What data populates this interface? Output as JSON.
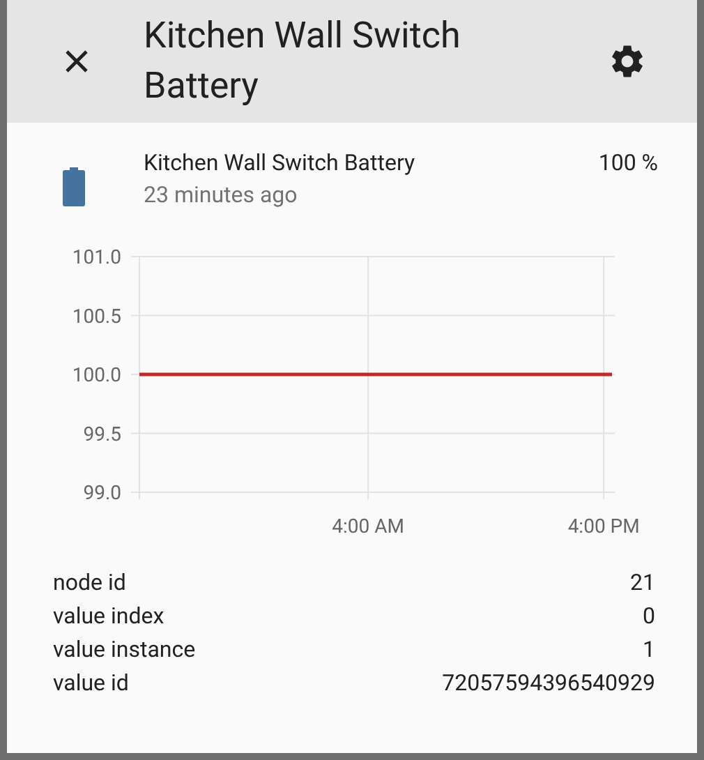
{
  "dialog": {
    "title": "Kitchen Wall Switch Battery"
  },
  "entity": {
    "name": "Kitchen Wall Switch Battery",
    "last_changed": "23 minutes ago",
    "state": "100 %"
  },
  "chart_data": {
    "type": "line",
    "grid": true,
    "x": [
      -7.65,
      16.42
    ],
    "series": [
      {
        "color": "#c62828",
        "values": [
          100,
          100
        ]
      }
    ],
    "xlim": [
      -7.65,
      16.42
    ],
    "ylim": [
      99,
      101
    ],
    "xticks": [
      {
        "value": 4,
        "label": "4:00 AM"
      },
      {
        "value": 16,
        "label": "4:00 PM"
      }
    ],
    "yticks": [
      {
        "value": 99,
        "label": "99.0"
      },
      {
        "value": 99.5,
        "label": "99.5"
      },
      {
        "value": 100,
        "label": "100.0"
      },
      {
        "value": 100.5,
        "label": "100.5"
      },
      {
        "value": 101,
        "label": "101.0"
      }
    ]
  },
  "attributes": [
    {
      "name": "node id",
      "value": "21"
    },
    {
      "name": "value index",
      "value": "0"
    },
    {
      "name": "value instance",
      "value": "1"
    },
    {
      "name": "value id",
      "value": "72057594396540929"
    }
  ]
}
